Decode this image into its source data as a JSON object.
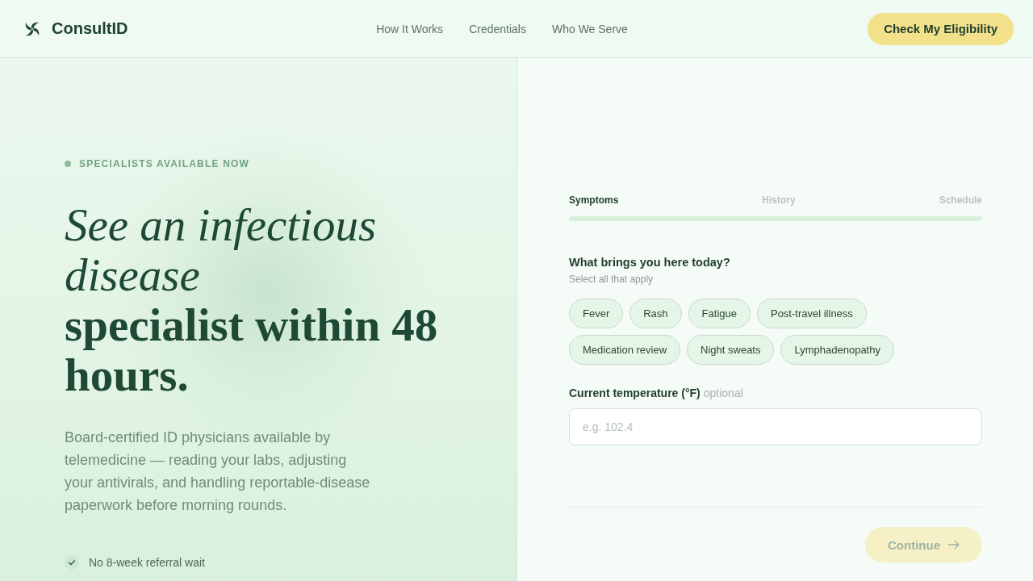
{
  "header": {
    "brand": "ConsultID",
    "nav": [
      "How It Works",
      "Credentials",
      "Who We Serve"
    ],
    "cta": "Check My Eligibility"
  },
  "hero": {
    "tag": "SPECIALISTS AVAILABLE NOW",
    "headline": "*See an infectious disease* **specialist within 48 hours.**",
    "description": "Board-certified ID physicians available by telemedicine — reading your labs, adjusting your antivirals, and handling reportable-disease paperwork before morning rounds.",
    "benefits": [
      "No 8-week referral wait"
    ]
  },
  "form": {
    "steps": [
      {
        "label": "Symptoms",
        "selected": true
      },
      {
        "label": "History",
        "selected": false
      },
      {
        "label": "Schedule",
        "selected": false
      }
    ],
    "question": "What brings you here today?",
    "hint": "Select all that apply",
    "symptoms": [
      {
        "label": "Fever",
        "selected": false
      },
      {
        "label": "Rash",
        "selected": false
      },
      {
        "label": "Fatigue",
        "selected": false
      },
      {
        "label": "Post-travel illness",
        "selected": false
      },
      {
        "label": "Medication review",
        "selected": false
      },
      {
        "label": "Night sweats",
        "selected": false
      },
      {
        "label": "Lymphadenopathy",
        "selected": false
      }
    ],
    "temperature": {
      "label": "Current temperature (°F)",
      "note": "optional",
      "placeholder": "e.g. 102.4"
    },
    "continue": {
      "label": "Continue",
      "disabled": true
    }
  }
}
